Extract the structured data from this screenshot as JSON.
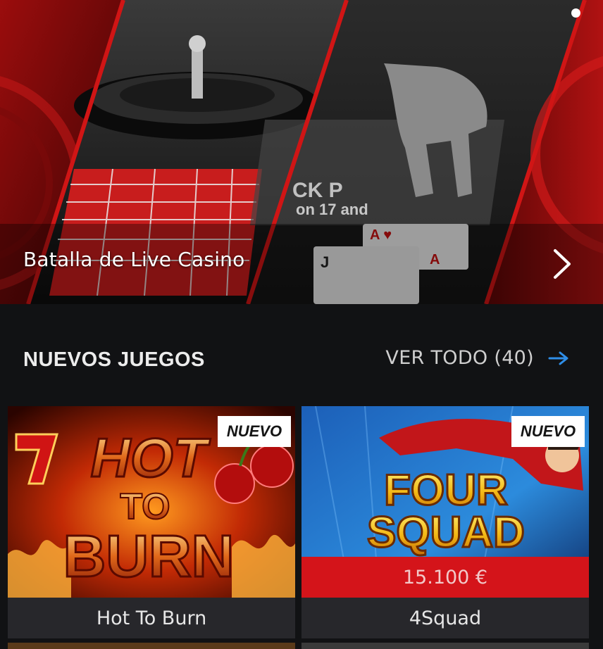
{
  "hero": {
    "title": "Batalla de Live Casino",
    "icon": "chevron-right-icon"
  },
  "section": {
    "title": "NUEVOS JUEGOS",
    "see_all_label": "VER TODO (40)",
    "see_all_icon": "arrow-right-icon",
    "accent_color": "#2f8ee8"
  },
  "games": [
    {
      "name": "Hot To Burn",
      "badge": "NUEVO",
      "art_title_line1": "HOT",
      "art_title_line2": "TO",
      "art_title_line3": "BURN"
    },
    {
      "name": "4Squad",
      "badge": "NUEVO",
      "jackpot": "15.100 €",
      "art_title_line1": "FOUR",
      "art_title_line2": "SQUAD"
    }
  ],
  "colors": {
    "background": "#111214",
    "jackpot_red": "#d4141a",
    "label_bg": "#27272b"
  }
}
